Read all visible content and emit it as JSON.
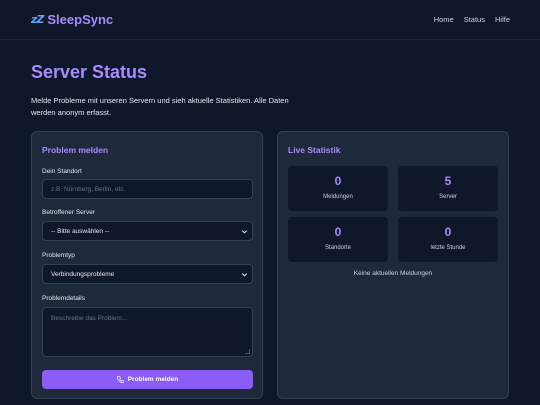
{
  "brand": {
    "name": "SleepSync",
    "icon": "zzz-icon"
  },
  "nav": {
    "home": "Home",
    "status": "Status",
    "help": "Hilfe"
  },
  "hero": {
    "title": "Server Status",
    "description": "Melde Probleme mit unseren Servern und sieh aktuelle Statistiken. Alle Daten werden anonym erfasst."
  },
  "report": {
    "title": "Problem melden",
    "location_label": "Dein Standort",
    "location_placeholder": "z.B. Nürnberg, Berlin, etc.",
    "server_label": "Betroffener Server",
    "server_selected": "-- Bitte auswählen --",
    "type_label": "Problemtyp",
    "type_selected": "Verbindungsprobleme",
    "details_label": "Problemdetails",
    "details_placeholder": "Beschreibe das Problem...",
    "submit_label": "Problem melden"
  },
  "stats": {
    "title": "Live Statistik",
    "reports": {
      "value": "0",
      "label": "Meldungen"
    },
    "servers": {
      "value": "5",
      "label": "Server"
    },
    "locations": {
      "value": "0",
      "label": "Standorte"
    },
    "last_hour": {
      "value": "0",
      "label": "letzte Stunde"
    },
    "empty_note": "Keine aktuellen Meldungen"
  },
  "colors": {
    "background": "#0f172a",
    "card": "#1e293b",
    "accent": "#a78bfa",
    "button": "#8b5cf6"
  }
}
